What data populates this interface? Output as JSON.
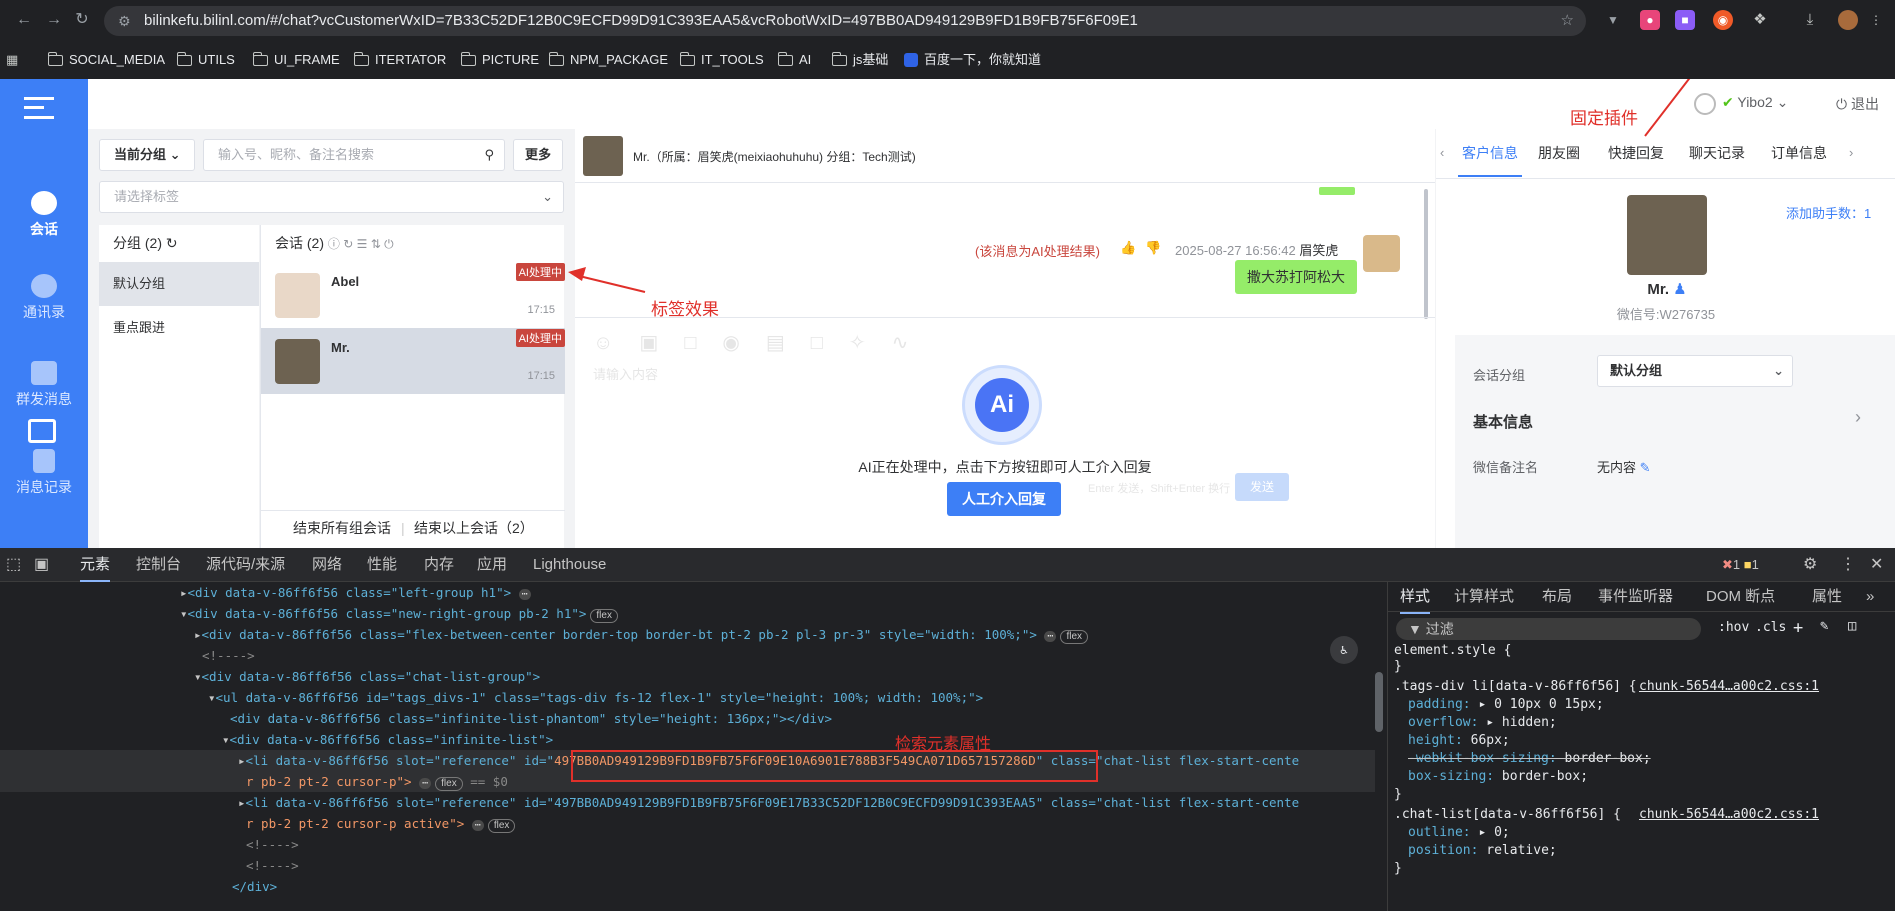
{
  "browser": {
    "url": "bilinkefu.bilinl.com/#/chat?vcCustomerWxID=7B33C52DF12B0C9ECFD99D91C393EAA5&vcRobotWxID=497BB0AD949129B9FD1B9FB75F6F09E1",
    "bookmarks": [
      "SOCIAL_MEDIA",
      "UTILS",
      "UI_FRAME",
      "ITERTATOR",
      "PICTURE",
      "NPM_PACKAGE",
      "IT_TOOLS",
      "AI",
      "js基础",
      "百度一下，你就知道"
    ]
  },
  "annotations": {
    "pin_plugin": "固定插件",
    "tag_effect": "标签效果",
    "inspect_attr": "检索元素属性"
  },
  "sidebar": {
    "items": [
      {
        "label": "会话",
        "active": true
      },
      {
        "label": "通讯录"
      },
      {
        "label": "群发消息"
      },
      {
        "label": "消息记录"
      }
    ]
  },
  "topbar": {
    "user": "Yibo2",
    "logout": "退出"
  },
  "left_panel": {
    "group_select": "当前分组",
    "search_placeholder": "输入号、昵称、备注名搜索",
    "more_button": "更多",
    "tag_placeholder": "请选择标签",
    "groups_header": "分组",
    "groups_count": "(2)",
    "groups": [
      "默认分组",
      "重点跟进"
    ],
    "sessions_header": "会话",
    "sessions_count": "(2)",
    "sessions": [
      {
        "name": "Abel",
        "tag": "AI处理中",
        "time": "17:15"
      },
      {
        "name": "Mr.",
        "tag": "AI处理中",
        "time": "17:15"
      }
    ],
    "end_all": "结束所有组会话",
    "end_above": "结束以上会话（2）"
  },
  "chat": {
    "header": "Mr.（所属：眉笑虎(meixiaohuhuhu) 分组：Tech测试)",
    "ai_note": "(该消息为AI处理结果)",
    "timestamp": "2025-08-27 16:56:42",
    "sender": "眉笑虎",
    "bubble": "撒大苏打阿松大",
    "input_placeholder": "请输入内容",
    "send_hint": "Enter 发送，Shift+Enter 换行",
    "send": "发送",
    "ai_logo": "Ai",
    "ai_processing": "AI正在处理中，点击下方按钮即可人工介入回复",
    "manual_button": "人工介入回复"
  },
  "right_panel": {
    "tabs": [
      "客户信息",
      "朋友圈",
      "快捷回复",
      "聊天记录",
      "订单信息"
    ],
    "add_helper": "添加助手数：1",
    "name": "Mr.",
    "wechat_id": "微信号:W276735",
    "group_label": "会话分组",
    "group_value": "默认分组",
    "basic_info": "基本信息",
    "remark_label": "微信备注名",
    "remark_value": "无内容"
  },
  "devtools": {
    "tabs": [
      "元素",
      "控制台",
      "源代码/来源",
      "网络",
      "性能",
      "内存",
      "应用",
      "Lighthouse"
    ],
    "errors": "1",
    "warnings": "1",
    "style_tabs": [
      "样式",
      "计算样式",
      "布局",
      "事件监听器",
      "DOM 断点",
      "属性"
    ],
    "filter": "过滤",
    "hov": ":hov",
    "cls": ".cls",
    "lines": [
      "<div data-v-86ff6f56 class=\"left-group h1\">",
      "<div data-v-86ff6f56 class=\"new-right-group pb-2 h1\">",
      "<div data-v-86ff6f56 class=\"flex-between-center border-top border-bt pt-2 pb-2 pl-3 pr-3\" style=\"width: 100%;\">",
      "<!---->",
      "<div data-v-86ff6f56 class=\"chat-list-group\">",
      "<ul data-v-86ff6f56 id=\"tags_divs-1\" class=\"tags-div fs-12 flex-1\" style=\"height: 100%; width: 100%;\">",
      "<div data-v-86ff6f56 class=\"infinite-list-phantom\" style=\"height: 136px;\"></div>",
      "<div data-v-86ff6f56 class=\"infinite-list\">"
    ],
    "li1_prefix": "<li data-v-86ff6f56 slot=\"reference\" id=\"",
    "li1_id": "497BB0AD949129B9FD1B9FB75F6F09E10A6901E788B3F549CA071D657157286D",
    "li1_suffix": "\" class=\"chat-list flex-start-cente",
    "li1_cont": "r pb-2 pt-2 cursor-p\">",
    "li2": "<li data-v-86ff6f56 slot=\"reference\" id=\"497BB0AD949129B9FD1B9FB75F6F09E17B33C52DF12B0C9ECFD99D91C393EAA5\" class=\"chat-list flex-start-cente",
    "li2_cont": "r pb-2 pt-2 cursor-p active\">",
    "css": [
      {
        "text": "element.style {"
      },
      {
        "text": "}"
      },
      {
        "text": ".tags-div li[data-v-86ff6f56] {",
        "src": "chunk-56544…a00c2.css:1"
      },
      {
        "prop": "padding",
        "val": "▸ 0 10px 0 15px;"
      },
      {
        "prop": "overflow",
        "val": "▸ hidden;"
      },
      {
        "prop": "height",
        "val": "66px;"
      },
      {
        "prop": "-webkit-box-sizing",
        "val": "border-box;",
        "strike": true
      },
      {
        "prop": "box-sizing",
        "val": "border-box;"
      },
      {
        "text": "}"
      },
      {
        "text": ".chat-list[data-v-86ff6f56] {",
        "src": "chunk-56544…a00c2.css:1"
      },
      {
        "prop": "outline",
        "val": "▸ 0;"
      },
      {
        "prop": "position",
        "val": "relative;"
      },
      {
        "text": "}"
      }
    ]
  },
  "colors": {
    "brand": "#3d7ff6",
    "accent_red": "#e0302a",
    "tag_red": "#c9463d",
    "bubble_green": "#95ec69"
  }
}
